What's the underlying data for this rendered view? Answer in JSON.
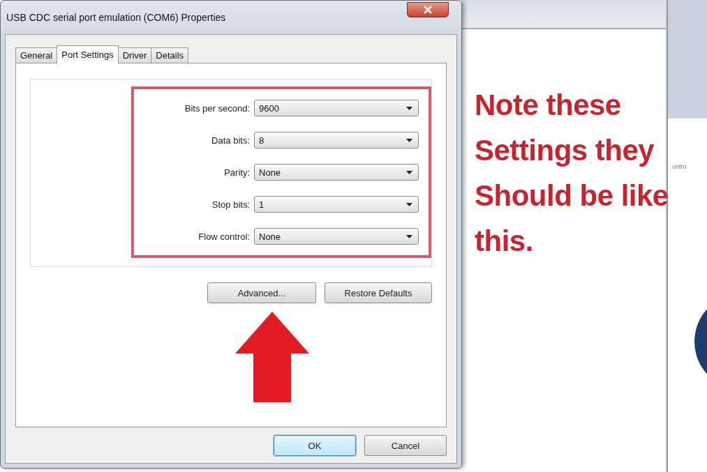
{
  "window": {
    "title": "USB CDC serial port emulation (COM6) Properties"
  },
  "tabs": [
    {
      "label": "General",
      "selected": false
    },
    {
      "label": "Port Settings",
      "selected": true
    },
    {
      "label": "Driver",
      "selected": false
    },
    {
      "label": "Details",
      "selected": false
    }
  ],
  "settings": [
    {
      "label": "Bits per second:",
      "value": "9600"
    },
    {
      "label": "Data bits:",
      "value": "8"
    },
    {
      "label": "Parity:",
      "value": "None"
    },
    {
      "label": "Stop bits:",
      "value": "1"
    },
    {
      "label": "Flow control:",
      "value": "None"
    }
  ],
  "panel_buttons": [
    "Advanced...",
    "Restore Defaults"
  ],
  "dialog_buttons": [
    {
      "label": "OK",
      "default": true
    },
    {
      "label": "Cancel",
      "default": false
    }
  ],
  "background_window_text": "ontro",
  "annotation": {
    "lines": [
      "Note these",
      "Settings they",
      "Should be like",
      "this."
    ]
  }
}
